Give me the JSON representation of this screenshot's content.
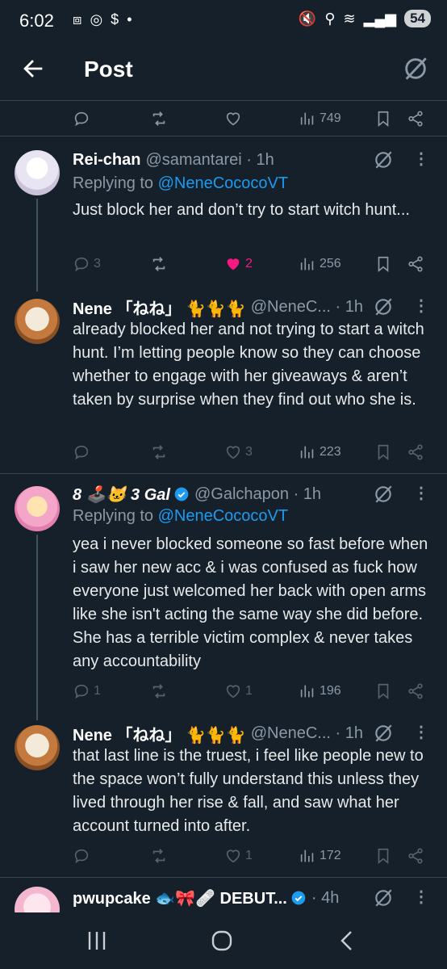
{
  "status_bar": {
    "time": "6:02",
    "left_icons": [
      "screenshot-icon",
      "instagram-icon",
      "dollar-icon",
      "dot-icon"
    ],
    "battery": "54"
  },
  "header": {
    "title": "Post"
  },
  "top_actions": {
    "views": "749"
  },
  "tweets": [
    {
      "name": "Rei-chan",
      "handle": "@samantarei · 1h",
      "replying_prefix": "Replying to ",
      "replying_to": "@NeneCococoVT",
      "text": "Just block her and don’t try to start witch hunt...",
      "replies": "3",
      "retweets": "",
      "likes": "2",
      "views": "256",
      "liked": true
    },
    {
      "name": "Nene 「ねね」 🐈🐈🐈",
      "handle": "@NeneC... · 1h",
      "text": "already blocked her and not trying to start a witch hunt. I’m letting people know so they can choose whether to engage with her giveaways & aren’t taken by surprise when they find out who she is.",
      "replies": "",
      "retweets": "",
      "likes": "3",
      "views": "223"
    },
    {
      "name": "8 🕹️🐱 3 Gal",
      "handle": "@Galchapon · 1h",
      "replying_prefix": "Replying to ",
      "replying_to": "@NeneCococoVT",
      "text": "yea i never blocked someone so fast before when i saw her new acc & i was confused as fuck how everyone just welcomed her back with open arms like she isn't acting the same way she did before. She has a terrible victim complex & never takes any accountability",
      "replies": "1",
      "retweets": "",
      "likes": "1",
      "views": "196"
    },
    {
      "name": "Nene 「ねね」 🐈🐈🐈",
      "handle": "@NeneC... · 1h",
      "text": "that last line is the truest, i feel like people new to the space won’t fully understand this unless they lived through her rise & fall, and saw what her account turned into after.",
      "replies": "",
      "retweets": "",
      "likes": "1",
      "views": "172"
    },
    {
      "name": "pwupcake 🐟🎀🩹 DEBUT...",
      "handle": "· 4h"
    }
  ],
  "colors": {
    "background": "#15202b",
    "accent": "#1d9bf0",
    "like": "#f91880",
    "muted": "#8b98a5"
  }
}
